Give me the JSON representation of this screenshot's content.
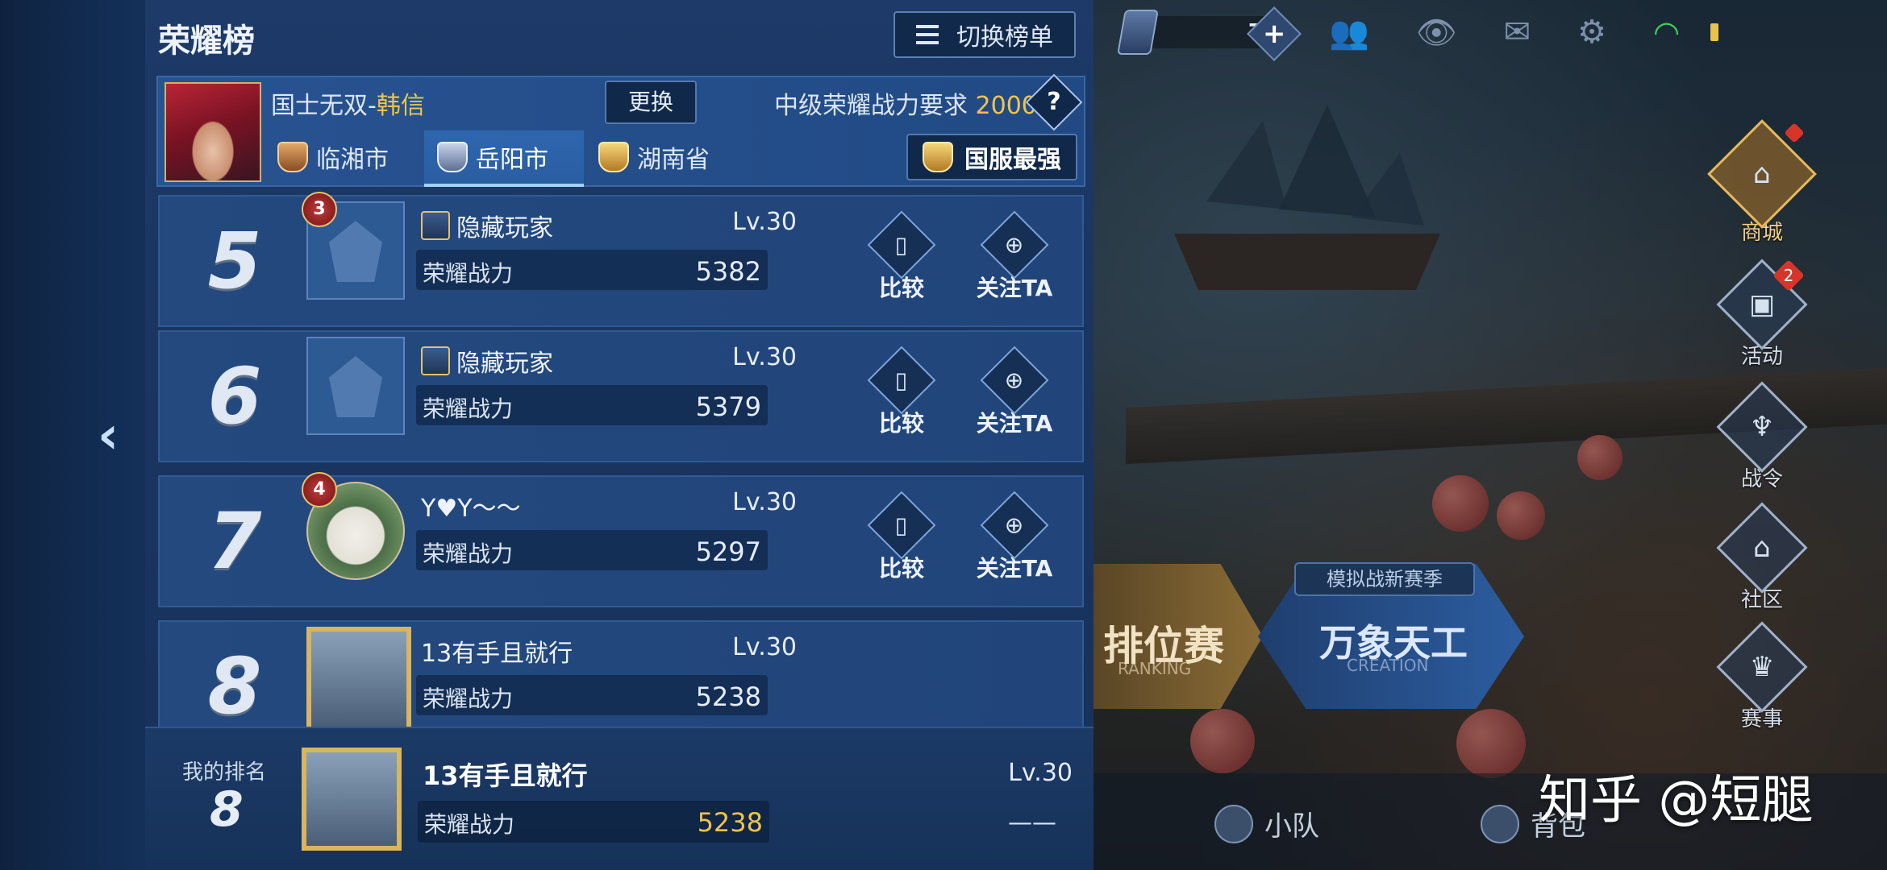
{
  "panel": {
    "title": "荣耀榜",
    "switch_label": "切换榜单"
  },
  "hero": {
    "title_prefix": "国士无双-",
    "hero_name": "韩信",
    "change_label": "更换",
    "requirement_label": "中级荣耀战力要求",
    "requirement_value": "2000",
    "help": "?"
  },
  "locations": [
    {
      "label": "临湘市",
      "active": false
    },
    {
      "label": "岳阳市",
      "active": true
    },
    {
      "label": "湖南省",
      "active": false
    }
  ],
  "national_label": "国服最强",
  "rows": [
    {
      "rank": "5",
      "badge": "3",
      "name": "隐藏玩家",
      "hidden": true,
      "level": "Lv.30",
      "power_label": "荣耀战力",
      "power": "5382",
      "compare": "比较",
      "follow": "关注TA"
    },
    {
      "rank": "6",
      "badge": "",
      "name": "隐藏玩家",
      "hidden": true,
      "level": "Lv.30",
      "power_label": "荣耀战力",
      "power": "5379",
      "compare": "比较",
      "follow": "关注TA"
    },
    {
      "rank": "7",
      "badge": "4",
      "name": "Y♥Y～～",
      "hidden": false,
      "level": "Lv.30",
      "power_label": "荣耀战力",
      "power": "5297",
      "compare": "比较",
      "follow": "关注TA"
    },
    {
      "rank": "8",
      "badge": "",
      "name": "13有手且就行",
      "hidden": false,
      "level": "Lv.30",
      "power_label": "荣耀战力",
      "power": "5238",
      "compare": "",
      "follow": ""
    }
  ],
  "my_rank": {
    "label": "我的排名",
    "rank": "8",
    "name": "13有手且就行",
    "level": "Lv.30",
    "power_label": "荣耀战力",
    "power": "5238",
    "dash": "——"
  },
  "topbar": {
    "gems": "7"
  },
  "side_menu": [
    {
      "label": "商城",
      "icon": "shop-icon",
      "badge": ""
    },
    {
      "label": "活动",
      "icon": "chest-icon",
      "badge": "2"
    },
    {
      "label": "战令",
      "icon": "dragon-icon",
      "badge": ""
    },
    {
      "label": "社区",
      "icon": "house-icon",
      "badge": ""
    },
    {
      "label": "赛事",
      "icon": "trophy-icon",
      "badge": ""
    }
  ],
  "modes": {
    "ranking": "排位赛",
    "ranking_en": "RANKING",
    "creation": "万象天工",
    "creation_en": "CREATION",
    "tag": "模拟战新赛季"
  },
  "bottom_nav": {
    "team": "小队",
    "bag": "背包"
  },
  "watermark": "知乎 @短腿",
  "colors": {
    "gold": "#f1c44b",
    "panel_bg": "#1d3a68",
    "row_bg": "#23497f"
  }
}
